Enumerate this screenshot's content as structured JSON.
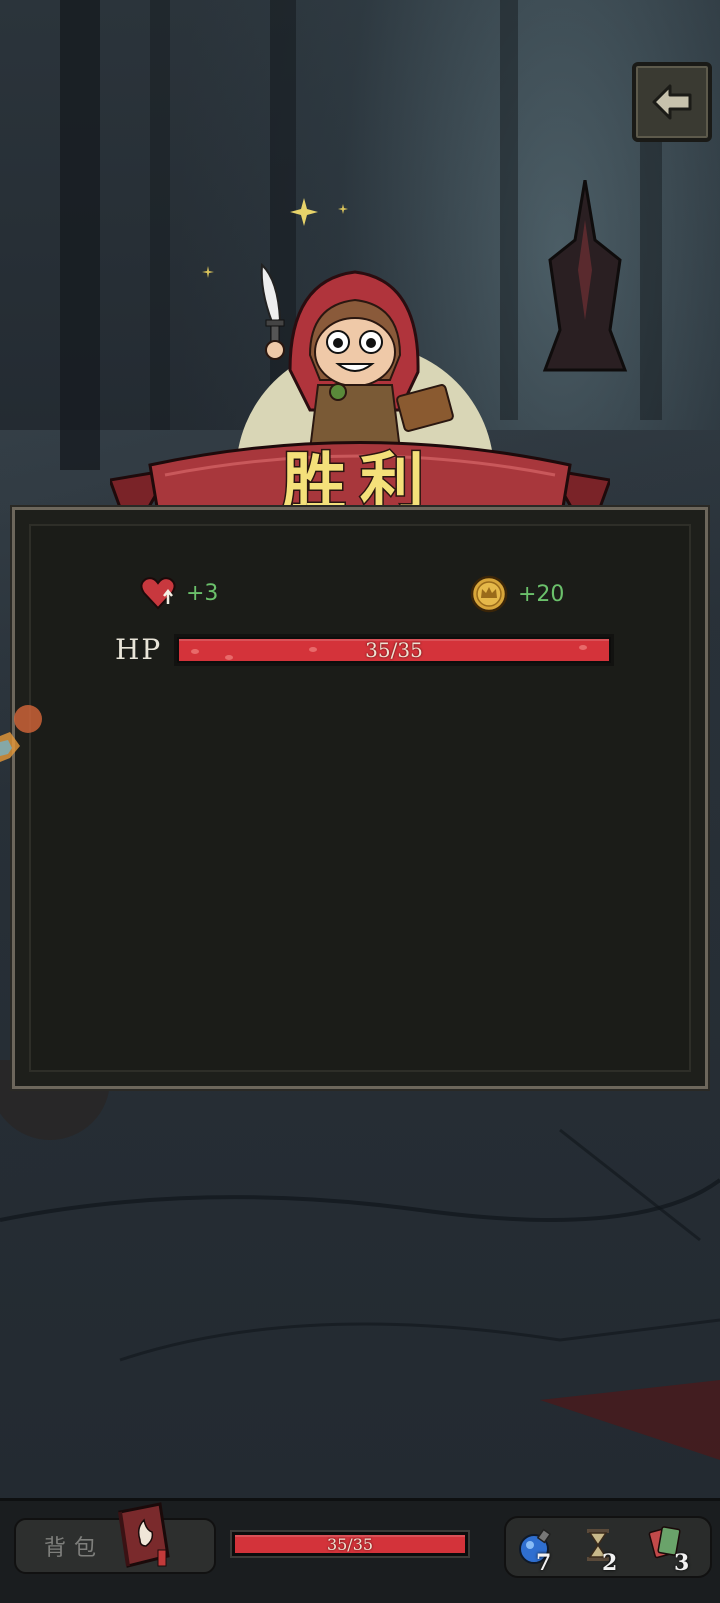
{
  "result": {
    "title": "胜利"
  },
  "rewards": {
    "max_hp_bonus": "+3",
    "gold_bonus": "+20"
  },
  "hp": {
    "label": "HP",
    "current": 35,
    "max": 35,
    "text": "35/35"
  },
  "bottom_bar": {
    "bag_label": "背包",
    "hp_text": "35/35",
    "potions": "7",
    "hourglass": "2",
    "cards": "3"
  },
  "colors": {
    "hp_fill": "#d4333a",
    "reward_text": "#6bc16b",
    "banner_title": "#f4e07a",
    "banner_ribbon": "#a8373c"
  },
  "icons": [
    "back-arrow-icon",
    "max-hp-heart-icon",
    "gold-coin-icon",
    "backpack-book-icon",
    "potion-icon",
    "hourglass-icon",
    "cards-icon"
  ]
}
